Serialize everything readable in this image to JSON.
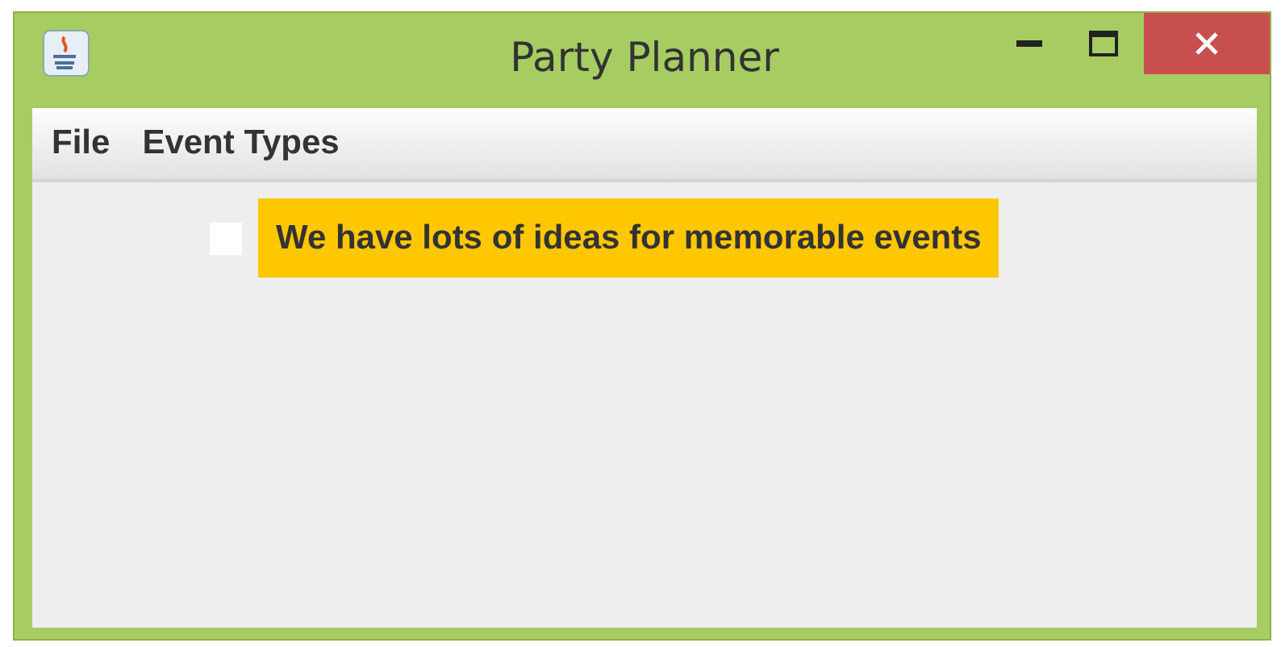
{
  "window": {
    "title": "Party Planner"
  },
  "menu": [
    {
      "label": "File"
    },
    {
      "label": "Event Types"
    }
  ],
  "checkbox": {
    "label": "We have lots of ideas for memorable events",
    "checked": false
  }
}
